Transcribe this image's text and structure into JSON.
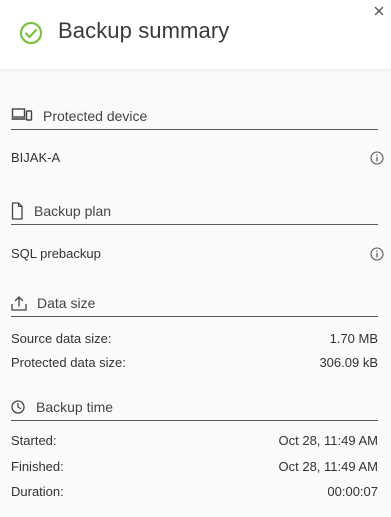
{
  "header": {
    "title": "Backup summary",
    "status_icon": "check-circle-icon",
    "accent": "#7ac142"
  },
  "sections": {
    "device": {
      "label": "Protected device",
      "icon": "devices-icon",
      "value": "BIJAK-A"
    },
    "plan": {
      "label": "Backup plan",
      "icon": "document-icon",
      "value": "SQL prebackup"
    },
    "data_size": {
      "label": "Data size",
      "icon": "upload-icon",
      "source_label": "Source data size:",
      "source_value": "1.70 MB",
      "protected_label": "Protected data size:",
      "protected_value": "306.09 kB"
    },
    "time": {
      "label": "Backup time",
      "icon": "clock-icon",
      "started_label": "Started:",
      "started_value": "Oct 28, 11:49 AM",
      "finished_label": "Finished:",
      "finished_value": "Oct 28, 11:49 AM",
      "duration_label": "Duration:",
      "duration_value": "00:00:07"
    }
  }
}
